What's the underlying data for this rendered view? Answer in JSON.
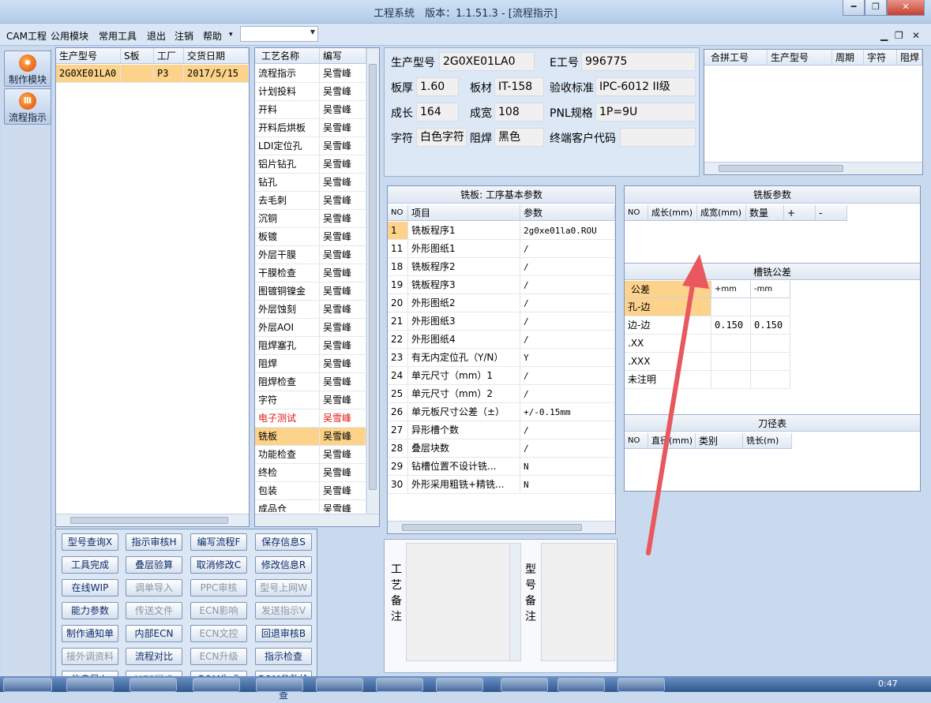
{
  "window": {
    "title": "工程系统　版本：1.1.51.3 - [流程指示]",
    "minimize": "━",
    "restore": "❐",
    "close": "✕"
  },
  "menu": {
    "items": [
      "CAM工程",
      "公用模块",
      "常用工具",
      "退出",
      "注销",
      "帮助"
    ],
    "help_arrow": "▾",
    "combo_value": "",
    "mdi_min": "▁",
    "mdi_restore": "❐",
    "mdi_close": "✕"
  },
  "sidebar": {
    "buttons": [
      {
        "label": "制作模块",
        "icon": "fire-icon"
      },
      {
        "label": "流程指示",
        "icon": "flow-icon"
      }
    ]
  },
  "orders": {
    "headers": [
      "生产型号",
      "S板",
      "工厂",
      "交货日期"
    ],
    "rows": [
      [
        "2G0XE01LA0",
        "",
        "P3",
        "2017/5/15"
      ]
    ]
  },
  "process": {
    "headers": [
      "工艺名称",
      "编写"
    ],
    "rows": [
      [
        "流程指示",
        "吴雪峰"
      ],
      [
        "计划投料",
        "吴雪峰"
      ],
      [
        "开料",
        "吴雪峰"
      ],
      [
        "开料后烘板",
        "吴雪峰"
      ],
      [
        "LDI定位孔",
        "吴雪峰"
      ],
      [
        "铝片钻孔",
        "吴雪峰"
      ],
      [
        "钻孔",
        "吴雪峰"
      ],
      [
        "去毛刺",
        "吴雪峰"
      ],
      [
        "沉铜",
        "吴雪峰"
      ],
      [
        "板镀",
        "吴雪峰"
      ],
      [
        "外层干膜",
        "吴雪峰"
      ],
      [
        "干膜检查",
        "吴雪峰"
      ],
      [
        "图镀铜镍金",
        "吴雪峰"
      ],
      [
        "外层蚀刻",
        "吴雪峰"
      ],
      [
        "外层AOI",
        "吴雪峰"
      ],
      [
        "阻焊塞孔",
        "吴雪峰"
      ],
      [
        "阻焊",
        "吴雪峰"
      ],
      [
        "阻焊检查",
        "吴雪峰"
      ],
      [
        "字符",
        "吴雪峰"
      ],
      [
        "电子测试",
        "吴雪峰"
      ],
      [
        "铣板",
        "吴雪峰"
      ],
      [
        "功能检查",
        "吴雪峰"
      ],
      [
        "终检",
        "吴雪峰"
      ],
      [
        "包装",
        "吴雪峰"
      ],
      [
        "成品仓",
        "吴雪峰"
      ]
    ],
    "highlight_red_index": 19,
    "selected_index": 20
  },
  "info": {
    "model_label": "生产型号",
    "model": "2G0XE01LA0",
    "eno_label": "E工号",
    "eno": "996775",
    "thick_label": "板厚",
    "thick": "1.60",
    "material_label": "板材",
    "material": "IT-158",
    "std_label": "验收标准",
    "std": "IPC-6012 II级",
    "len_label": "成长",
    "len": "164",
    "wid_label": "成宽",
    "wid": "108",
    "pnl_label": "PNL规格",
    "pnl": "1P=9U",
    "char_label": "字符",
    "char": "白色字符",
    "mask_label": "阻焊",
    "mask": "黑色",
    "cust_label": "终端客户代码",
    "cust": ""
  },
  "merge": {
    "headers": [
      "合拼工号",
      "生产型号",
      "周期",
      "字符",
      "阻焊"
    ]
  },
  "params": {
    "title": "铣板: 工序基本参数",
    "headers": [
      "NO",
      "项目",
      "参数"
    ],
    "rows": [
      [
        "1",
        "铣板程序1",
        "2g0xe01la0.ROU"
      ],
      [
        "11",
        "外形图纸1",
        "/"
      ],
      [
        "18",
        "铣板程序2",
        "/"
      ],
      [
        "19",
        "铣板程序3",
        "/"
      ],
      [
        "20",
        "外形图纸2",
        "/"
      ],
      [
        "21",
        "外形图纸3",
        "/"
      ],
      [
        "22",
        "外形图纸4",
        "/"
      ],
      [
        "23",
        "有无内定位孔（Y/N）",
        "Y"
      ],
      [
        "24",
        "单元尺寸（mm）1",
        "/"
      ],
      [
        "25",
        "单元尺寸（mm）2",
        "/"
      ],
      [
        "26",
        "单元板尺寸公差（±）",
        "+/-0.15mm"
      ],
      [
        "27",
        "异形槽个数",
        "/"
      ],
      [
        "28",
        "叠层块数",
        "/"
      ],
      [
        "29",
        "钻槽位置不设计铣...",
        "N"
      ],
      [
        "30",
        "外形采用粗铣+精铣...",
        "N"
      ]
    ]
  },
  "mill": {
    "title": "铣板参数",
    "headers": [
      "NO",
      "成长(mm)",
      "成宽(mm)",
      "数量",
      "+",
      "-"
    ]
  },
  "slot": {
    "title": "槽铣公差",
    "headers": [
      "公差",
      "+mm",
      "-mm"
    ],
    "rows": [
      [
        "孔-边",
        "",
        ""
      ],
      [
        "边-边",
        "0.150",
        "0.150"
      ],
      [
        ".XX",
        "",
        ""
      ],
      [
        ".XXX",
        "",
        ""
      ],
      [
        "未注明",
        "",
        ""
      ]
    ]
  },
  "tool": {
    "title": "刀径表",
    "headers": [
      "NO",
      "直径(mm)",
      "类别",
      "铣长(m)"
    ]
  },
  "remarks": {
    "process_label": "工艺备注",
    "model_label": "型号备注"
  },
  "buttons": [
    [
      "型号查询X",
      "指示审核H",
      "编写流程F",
      "保存信息S"
    ],
    [
      "工具完成",
      "叠层验算",
      "取消修改C",
      "修改信息R"
    ],
    [
      "在线WIP",
      "调单导入",
      "PPC审核",
      "型号上网W"
    ],
    [
      "能力参数",
      "传送文件",
      "ECN影响",
      "发送指示V"
    ],
    [
      "制作通知单",
      "内部ECN",
      "ECN文控",
      "回退审核B"
    ],
    [
      "接外调资料",
      "流程对比",
      "ECN升级",
      "指示检查"
    ],
    [
      "信息导入",
      "MES同步",
      "BOM生成",
      "BOM参数检查"
    ]
  ],
  "disabled_buttons": [
    "调单导入",
    "PPC审核",
    "型号上网W",
    "传送文件",
    "ECN影响",
    "发送指示V",
    "ECN文控",
    "接外调资料",
    "ECN升级",
    "MES同步"
  ],
  "taskbar": {
    "clock": "0:47"
  },
  "colors": {
    "selected": "#fdd28a",
    "red_text": "#e01818",
    "arrow": "#e8585e",
    "link_blue": "#0b2a6b"
  }
}
